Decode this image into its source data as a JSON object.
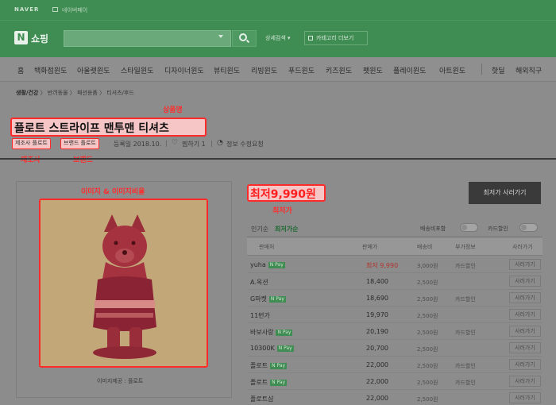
{
  "header": {
    "naver_logo": "NAVER",
    "util_link": "네이버페이",
    "shop_logo_letter": "N",
    "shop_title": "쇼핑",
    "search_placeholder": "",
    "detail_search": "상세검색 ▾",
    "category_button": "카테고리 더보기"
  },
  "category_nav": [
    "홈",
    "백화점윈도",
    "아울렛윈도",
    "스타일윈도",
    "디자이너윈도",
    "뷰티윈도",
    "리빙윈도",
    "푸드윈도",
    "키즈윈도",
    "펫윈도",
    "플레이윈도",
    "아트윈도",
    "핫딜",
    "해외직구"
  ],
  "breadcrumb": {
    "root": "생활/건강",
    "rest": "〉 반려동물 〉 패션용품 〉 티셔츠/후드"
  },
  "annotations": {
    "product_name": "상품명",
    "maker": "제조사",
    "brand": "브랜드",
    "image_ratio": "이미지 & 이미지비율",
    "lowest_price": "최저가"
  },
  "product": {
    "title": "플로트 스트라이프 맨투맨 티셔츠",
    "maker_tag": "제조사 플로트",
    "brand_tag": "브랜드 플로트",
    "reg_date": "등록일 2018.10.",
    "like": "찜하기 1",
    "report": "정보 수정요청",
    "image_caption": "이미지제공 : 플로트"
  },
  "price": {
    "lowest": "최저9,990원",
    "buy_button": "최저가 사러가기"
  },
  "sort": {
    "options": [
      "인기순",
      "최저가순"
    ],
    "toggles": [
      "배송비포함",
      "카드할인"
    ]
  },
  "table": {
    "headers": [
      "판매처",
      "판매가",
      "배송비",
      "부가정보",
      "사러가기"
    ],
    "rows": [
      {
        "mall": "yuha",
        "npay": true,
        "price": "최저 9,990",
        "ship": "3,000원",
        "extra": "카드할인",
        "buy": "사러가기",
        "low": true
      },
      {
        "mall": "A.옥션",
        "npay": false,
        "price": "18,400",
        "ship": "2,500원",
        "extra": "",
        "buy": "사러가기",
        "low": false
      },
      {
        "mall": "G마켓",
        "npay": true,
        "price": "18,690",
        "ship": "2,500원",
        "extra": "카드할인",
        "buy": "사러가기",
        "low": false
      },
      {
        "mall": "11번가",
        "npay": false,
        "price": "19,970",
        "ship": "2,500원",
        "extra": "",
        "buy": "사러가기",
        "low": false
      },
      {
        "mall": "바보사랑",
        "npay": true,
        "price": "20,190",
        "ship": "2,500원",
        "extra": "카드할인",
        "buy": "사러가기",
        "low": false
      },
      {
        "mall": "10300K",
        "npay": true,
        "price": "20,700",
        "ship": "2,500원",
        "extra": "",
        "buy": "사러가기",
        "low": false
      },
      {
        "mall": "플로트",
        "npay": true,
        "price": "22,000",
        "ship": "2,500원",
        "extra": "카드할인",
        "buy": "사러가기",
        "low": false
      },
      {
        "mall": "플로트",
        "npay": true,
        "price": "22,000",
        "ship": "2,500원",
        "extra": "카드할인",
        "buy": "사러가기",
        "low": false
      },
      {
        "mall": "플로트샵",
        "npay": false,
        "price": "22,000",
        "ship": "2,500원",
        "extra": "",
        "buy": "사러가기",
        "low": false
      }
    ]
  },
  "colors": {
    "highlight_border": "#ff2b2b",
    "highlight_text": "#ff2d2d",
    "naver_green": "#3f8d52",
    "dim_overlay": "#8c8c8c"
  },
  "icons": [
    "search-icon",
    "heart-icon",
    "bell-icon",
    "chevron-down-icon"
  ]
}
